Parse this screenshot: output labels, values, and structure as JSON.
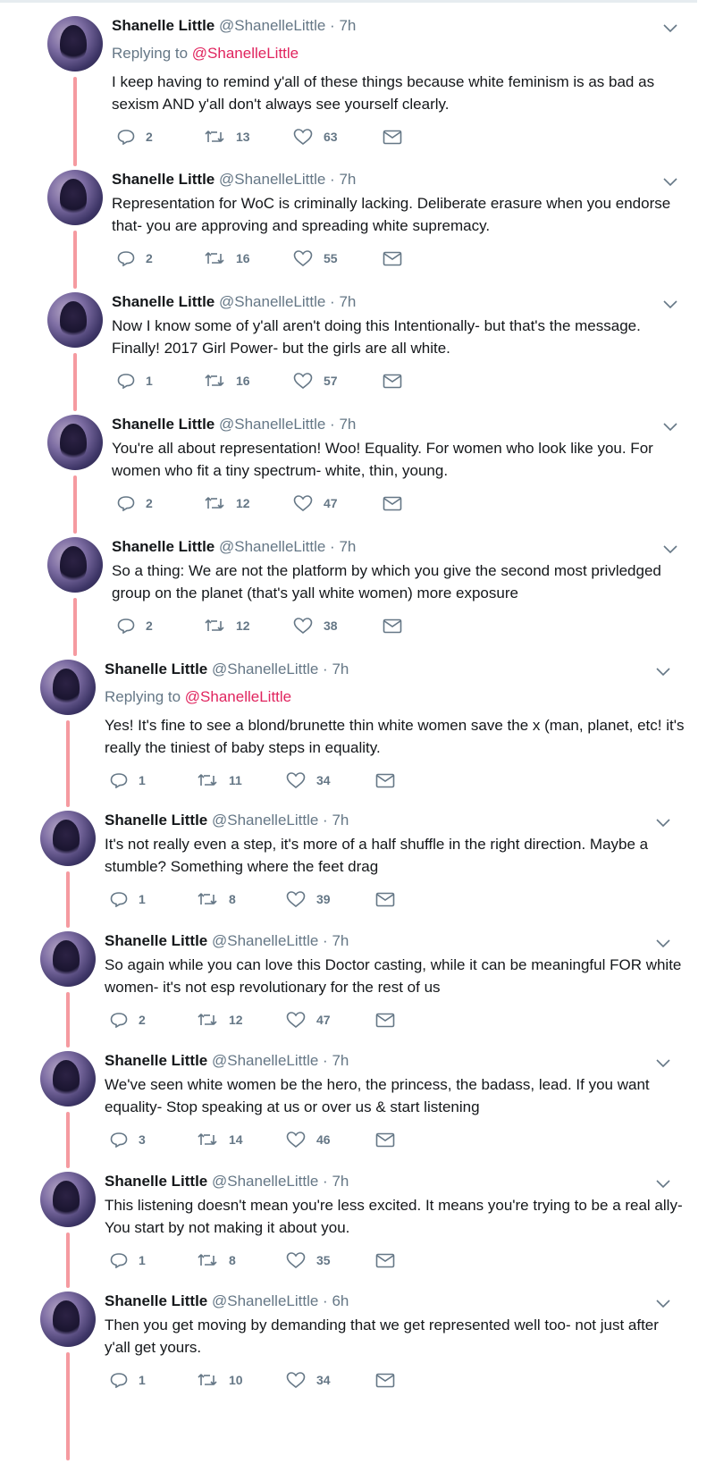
{
  "author": {
    "name": "Shanelle Little",
    "handle": "@ShanelleLittle"
  },
  "tweets": [
    {
      "time": "7h",
      "reply_label": "Replying to",
      "reply_to": "@ShanelleLittle",
      "text": "I keep having to remind y'all of these things because white feminism is as bad as sexism AND y'all don't always see yourself clearly.",
      "replies": "2",
      "retweets": "13",
      "likes": "63"
    },
    {
      "time": "7h",
      "text": "Representation for WoC is criminally lacking.  Deliberate erasure when you endorse that-  you are approving and spreading white supremacy.",
      "replies": "2",
      "retweets": "16",
      "likes": "55"
    },
    {
      "time": "7h",
      "text": "Now I know some of y'all aren't doing this Intentionally- but that's the message. Finally! 2017 Girl Power- but the girls are all white.",
      "replies": "1",
      "retweets": "16",
      "likes": "57"
    },
    {
      "time": "7h",
      "text": "You're all about representation! Woo! Equality.  For women who look like you.  For women who fit a tiny spectrum- white, thin, young.",
      "replies": "2",
      "retweets": "12",
      "likes": "47"
    },
    {
      "time": "7h",
      "text": "So a thing: We are not the platform by which you give the second most privledged group on the planet (that's yall white women) more exposure",
      "replies": "2",
      "retweets": "12",
      "likes": "38"
    },
    {
      "time": "7h",
      "reply_label": "Replying to",
      "reply_to": "@ShanelleLittle",
      "text": "Yes! It's fine to see a blond/brunette thin white women save the x (man, planet, etc! it's really the tiniest of baby steps in equality.",
      "replies": "1",
      "retweets": "11",
      "likes": "34"
    },
    {
      "time": "7h",
      "text": "It's not really even a step, it's more of a half shuffle in the right direction. Maybe a stumble? Something where the feet drag",
      "replies": "1",
      "retweets": "8",
      "likes": "39"
    },
    {
      "time": "7h",
      "text": "So again while you can love this Doctor casting, while it can be meaningful FOR white women- it's not esp revolutionary for the rest of us",
      "replies": "2",
      "retweets": "12",
      "likes": "47"
    },
    {
      "time": "7h",
      "text": "We've seen white women be the hero, the princess, the badass, lead.  If you want equality- Stop speaking at us or over us & start listening",
      "replies": "3",
      "retweets": "14",
      "likes": "46"
    },
    {
      "time": "7h",
      "text": "This listening doesn't mean you're less excited.  It means you're trying to be a real ally- You start by not making it about you.",
      "replies": "1",
      "retweets": "8",
      "likes": "35"
    },
    {
      "time": "6h",
      "text": "Then you get moving by demanding that we get represented well too- not just after y'all get yours.",
      "replies": "1",
      "retweets": "10",
      "likes": "34"
    }
  ],
  "colors": {
    "thread_line": "#f59aa0",
    "mention": "#e0245e",
    "meta": "#657786"
  },
  "icons": [
    "reply-icon",
    "retweet-icon",
    "like-icon",
    "dm-icon",
    "chevron-down-icon",
    "avatar"
  ]
}
